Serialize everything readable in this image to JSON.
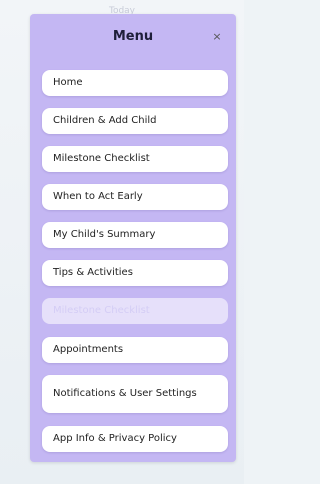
{
  "background": {
    "title": "Today"
  },
  "menu": {
    "title": "Menu",
    "close_glyph": "×",
    "items": [
      {
        "label": "Home"
      },
      {
        "label": "Children & Add Child"
      },
      {
        "label": "Milestone Checklist"
      },
      {
        "label": "When to Act Early"
      },
      {
        "label": "My Child's Summary"
      },
      {
        "label": "Tips & Activities"
      },
      {
        "label": "Milestone Checklist"
      },
      {
        "label": "Appointments"
      },
      {
        "label": "Notifications & User Settings"
      },
      {
        "label": "App Info & Privacy Policy"
      }
    ]
  },
  "colors": {
    "panel": "#c4b7f3",
    "item_background": "#ffffff",
    "faded_item": "#e6e0fa",
    "page_background": "#eef3f6"
  },
  "icons": {
    "close": "close-icon"
  }
}
